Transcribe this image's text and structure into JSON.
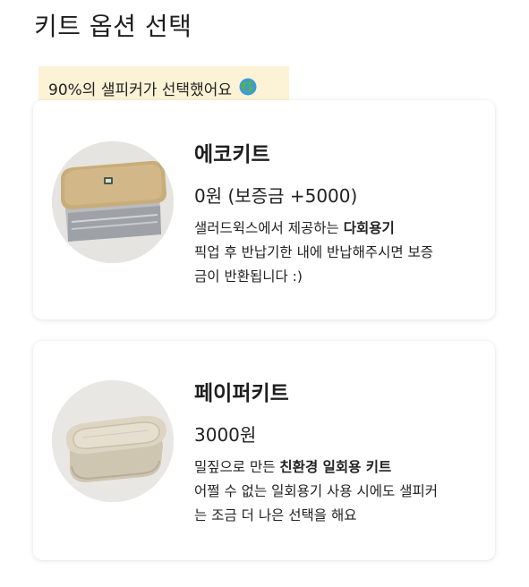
{
  "page": {
    "title": "키트 옵션 선택"
  },
  "badge": {
    "text": "90%의 샐피커가 선택했어요",
    "icon": "globe-icon"
  },
  "options": [
    {
      "name": "에코키트",
      "price": "0원 (보증금 +5000)",
      "desc_prefix": "샐러드윅스에서 제공하는 ",
      "desc_bold": "다회용기",
      "desc_line2": "픽업 후 반납기한 내에 반납해주시면 보증",
      "desc_line3": "금이 반환됩니다 :)",
      "image": "foil-container-with-kraft-lid"
    },
    {
      "name": "페이퍼키트",
      "price": "3000원",
      "desc_prefix": "밀짚으로 만든 ",
      "desc_bold": "친환경 일회용 키트",
      "desc_line2": "어쩔 수 없는 일회용기 사용 시에도 샐피커",
      "desc_line3": "는 조금 더 나은 선택을 해요",
      "image": "pulp-paper-container"
    }
  ],
  "colors": {
    "badge_bg": "#fcf2d6",
    "text": "#222222",
    "card_bg": "#ffffff"
  }
}
